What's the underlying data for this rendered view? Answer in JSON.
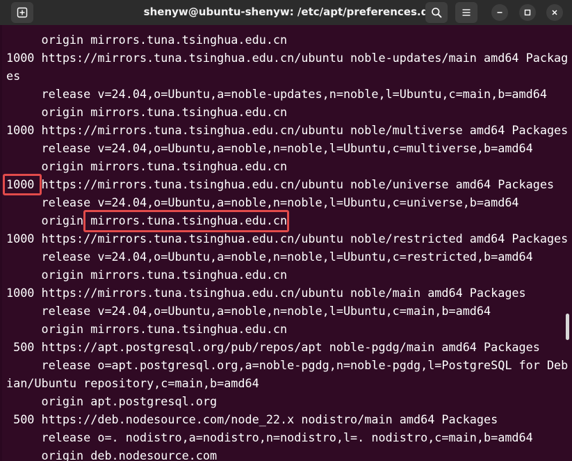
{
  "window": {
    "title": "shenyw@ubuntu-shenyw: /etc/apt/preferences.d"
  },
  "icons": {
    "new_tab": "new-tab-icon",
    "search": "search-icon",
    "menu": "hamburger-menu-icon",
    "minimize": "minimize-icon",
    "maximize": "maximize-icon",
    "close": "close-icon"
  },
  "colors": {
    "terminal_bg": "#300a24",
    "titlebar_bg": "#2c2c2c",
    "text": "#ffffff",
    "highlight_box": "#e24b4b"
  },
  "terminal": {
    "lines": [
      "     origin mirrors.tuna.tsinghua.edu.cn",
      "1000 https://mirrors.tuna.tsinghua.edu.cn/ubuntu noble-updates/main amd64 Packag",
      "es",
      "     release v=24.04,o=Ubuntu,a=noble-updates,n=noble,l=Ubuntu,c=main,b=amd64",
      "     origin mirrors.tuna.tsinghua.edu.cn",
      "1000 https://mirrors.tuna.tsinghua.edu.cn/ubuntu noble/multiverse amd64 Packages",
      "     release v=24.04,o=Ubuntu,a=noble,n=noble,l=Ubuntu,c=multiverse,b=amd64",
      "     origin mirrors.tuna.tsinghua.edu.cn",
      "1000 https://mirrors.tuna.tsinghua.edu.cn/ubuntu noble/universe amd64 Packages",
      "     release v=24.04,o=Ubuntu,a=noble,n=noble,l=Ubuntu,c=universe,b=amd64",
      "     origin mirrors.tuna.tsinghua.edu.cn",
      "1000 https://mirrors.tuna.tsinghua.edu.cn/ubuntu noble/restricted amd64 Packages",
      "     release v=24.04,o=Ubuntu,a=noble,n=noble,l=Ubuntu,c=restricted,b=amd64",
      "     origin mirrors.tuna.tsinghua.edu.cn",
      "1000 https://mirrors.tuna.tsinghua.edu.cn/ubuntu noble/main amd64 Packages",
      "     release v=24.04,o=Ubuntu,a=noble,n=noble,l=Ubuntu,c=main,b=amd64",
      "     origin mirrors.tuna.tsinghua.edu.cn",
      " 500 https://apt.postgresql.org/pub/repos/apt noble-pgdg/main amd64 Packages",
      "     release o=apt.postgresql.org,a=noble-pgdg,n=noble-pgdg,l=PostgreSQL for Deb",
      "ian/Ubuntu repository,c=main,b=amd64",
      "     origin apt.postgresql.org",
      " 500 https://deb.nodesource.com/node_22.x nodistro/main amd64 Packages",
      "     release o=. nodistro,a=nodistro,n=nodistro,l=. nodistro,c=main,b=amd64",
      "     origin deb.nodesource.com"
    ]
  }
}
